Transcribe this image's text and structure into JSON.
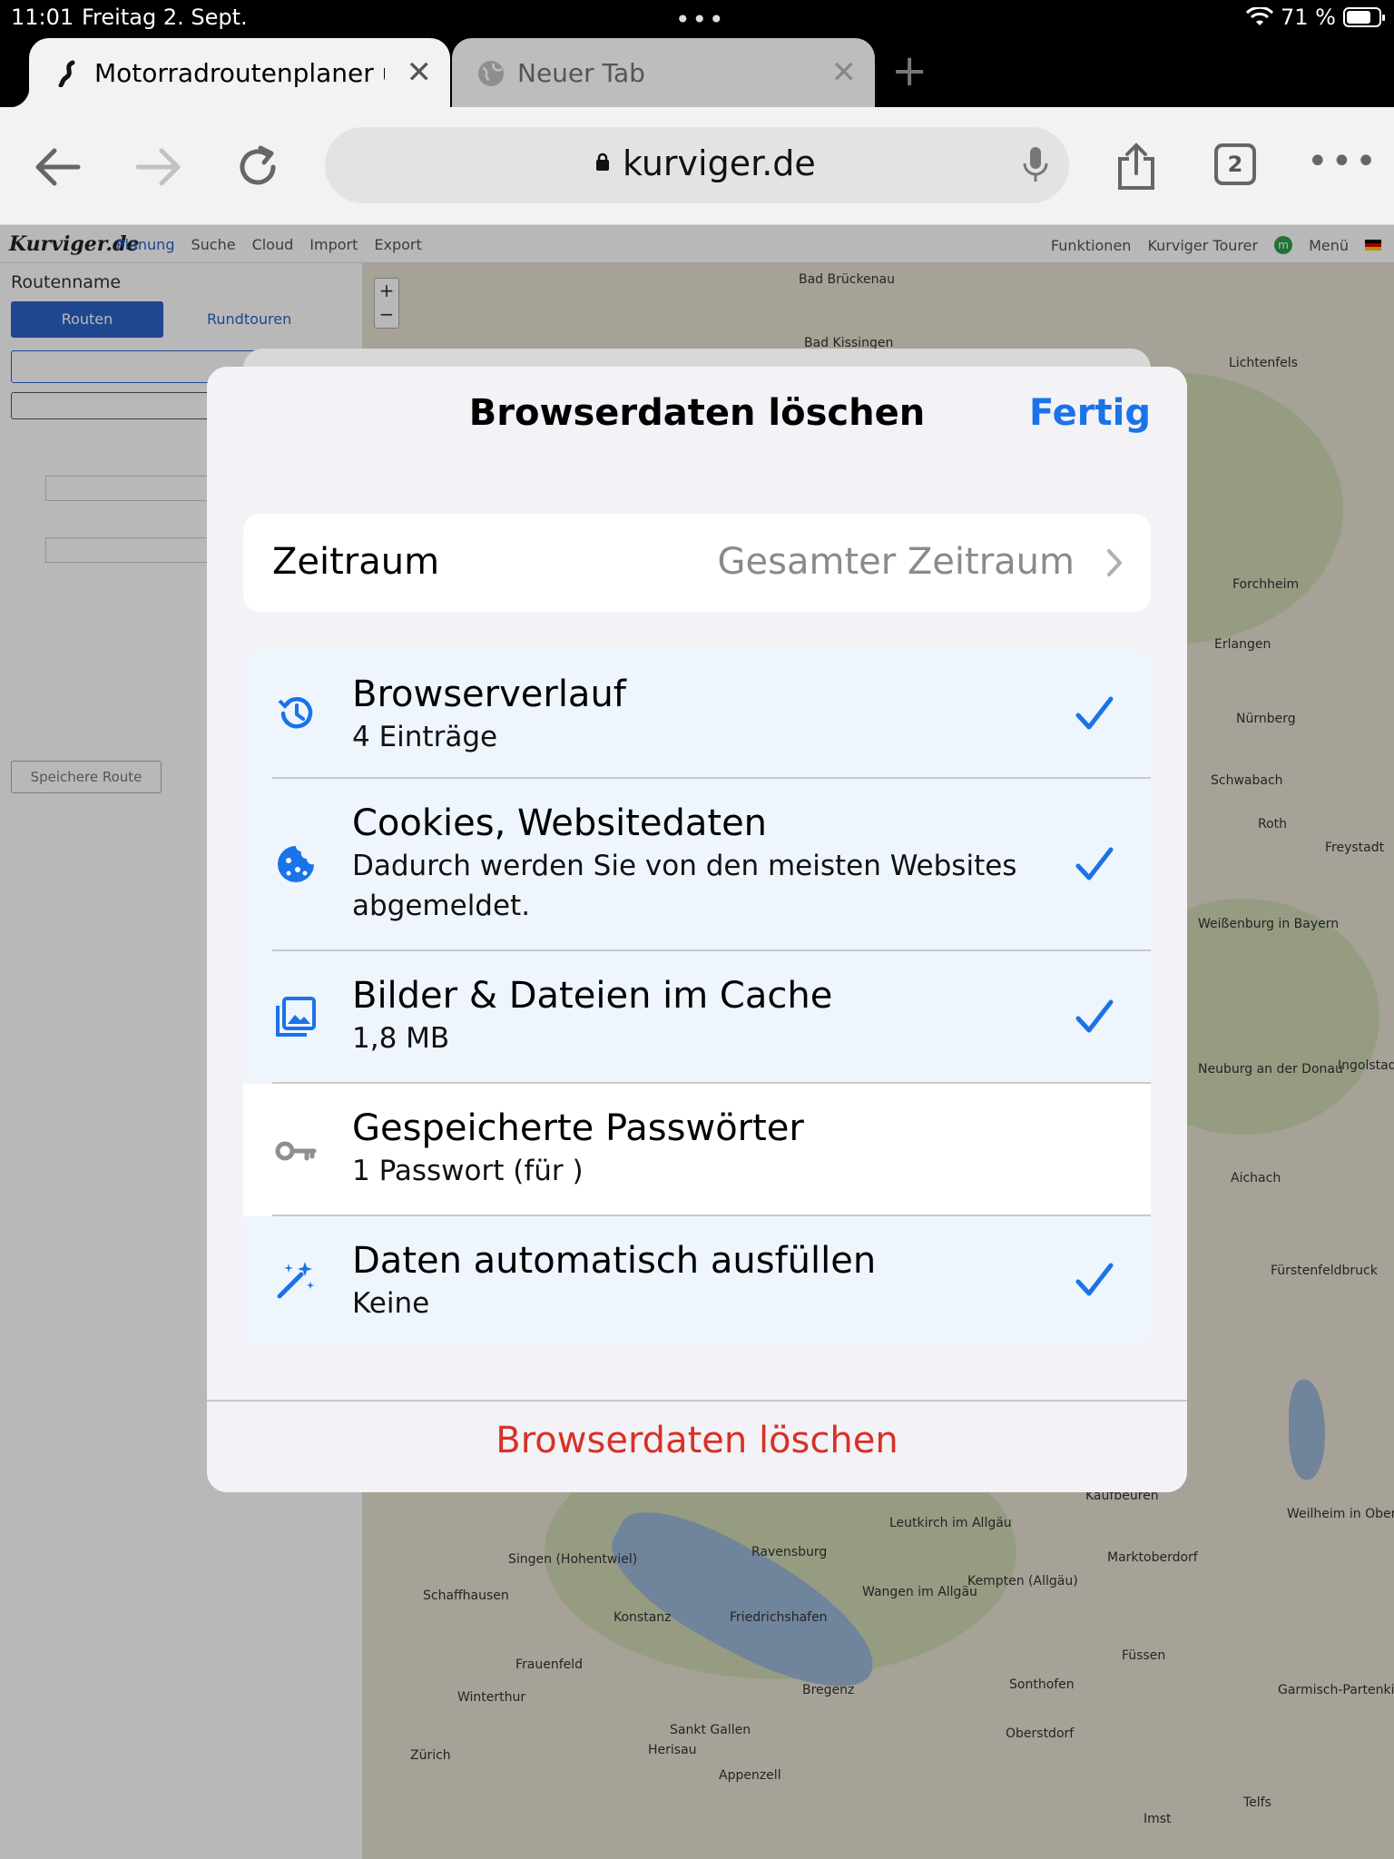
{
  "status": {
    "time": "11:01",
    "date": "Freitag 2. Sept.",
    "battery": "71 %"
  },
  "tabs": [
    {
      "label": "Motorradroutenplaner un",
      "active": true
    },
    {
      "label": "Neuer Tab",
      "active": false
    }
  ],
  "toolbar": {
    "url": "kurviger.de",
    "tab_count": "2"
  },
  "site": {
    "logo": "Kurviger.de",
    "nav": [
      "Planung",
      "Suche",
      "Cloud",
      "Import",
      "Export"
    ],
    "nav_right": [
      "Funktionen",
      "Kurviger Tourer",
      "m",
      "Menü"
    ],
    "route_name": "Routenname",
    "routes_button": "Routen",
    "rundtouren": "Rundtouren",
    "save_route": "Speichere Route"
  },
  "map_towns": [
    "Bad Brückenau",
    "Bad Kissingen",
    "Lichtenfels",
    "Forchheim",
    "Erlangen",
    "Nürnberg",
    "Schwabach",
    "Roth",
    "Freystadt",
    "Weißenburg in Bayern",
    "Neuburg an der Donau",
    "Ingolstadt",
    "Aichach",
    "Fürstenfeldbruck",
    "Kaufbeuren",
    "Weilheim in Oberbayern",
    "Marktoberdorf",
    "Kempten (Allgäu)",
    "Ravensburg",
    "Leutkirch im Allgäu",
    "Friedrichshafen",
    "Konstanz",
    "Singen (Hohentwiel)",
    "Schaffhausen",
    "Frauenfeld",
    "Winterthur",
    "Zürich",
    "Sankt Gallen",
    "Herisau",
    "Appenzell",
    "Bregenz",
    "Wangen im Allgäu",
    "Sonthofen",
    "Oberstdorf",
    "Füssen",
    "Garmisch-Partenkirchen",
    "Imst",
    "Telfs"
  ],
  "dialog": {
    "title": "Browserdaten löschen",
    "done": "Fertig",
    "timerange_label": "Zeitraum",
    "timerange_value": "Gesamter Zeitraum",
    "items": [
      {
        "title": "Browserverlauf",
        "subtitle": "4 Einträge",
        "checked": true,
        "icon": "history-icon"
      },
      {
        "title": "Cookies, Websitedaten",
        "subtitle": "Dadurch werden Sie von den meisten Websites abgemeldet.",
        "checked": true,
        "icon": "cookie-icon"
      },
      {
        "title": "Bilder & Dateien im Cache",
        "subtitle": "1,8 MB",
        "checked": true,
        "icon": "image-cache-icon"
      },
      {
        "title": "Gespeicherte Passwörter",
        "subtitle": "1 Passwort (für )",
        "checked": false,
        "icon": "key-icon"
      },
      {
        "title": "Daten automatisch ausfüllen",
        "subtitle": "Keine",
        "checked": true,
        "icon": "magic-wand-icon"
      }
    ],
    "clear_button": "Browserdaten löschen"
  },
  "colors": {
    "accent": "#1a73e8",
    "destructive": "#d93025",
    "selected_row": "#eef5fc"
  }
}
